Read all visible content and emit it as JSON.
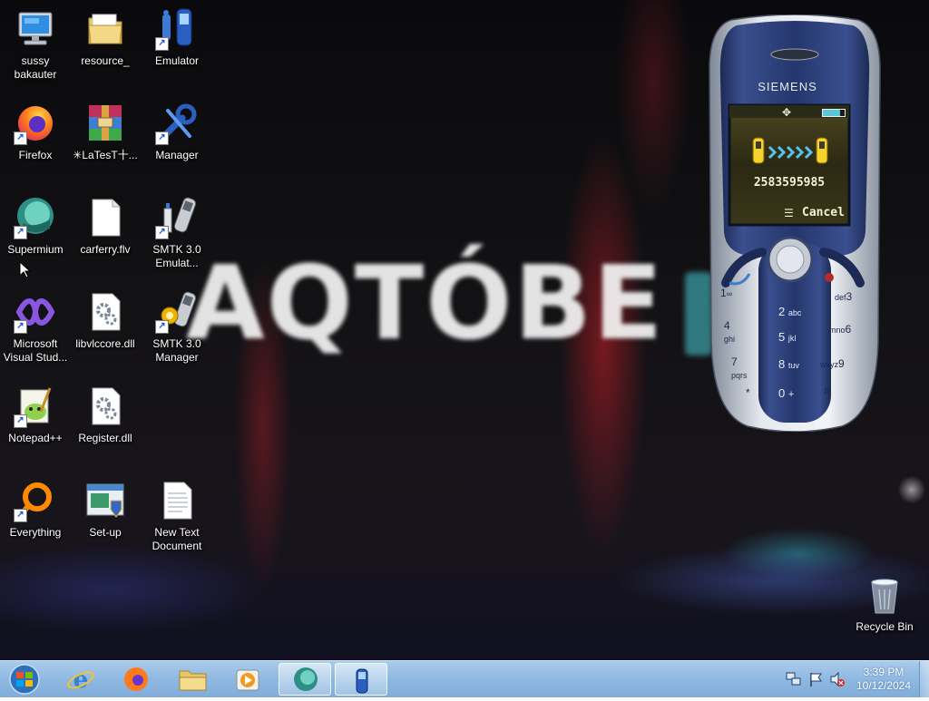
{
  "desktop": {
    "wallpaper_text": "AQTÓBE",
    "icons": [
      {
        "id": "sussy",
        "label": "sussy bakauter",
        "icon": "computer-icon",
        "shortcut": false
      },
      {
        "id": "resource",
        "label": "resource_",
        "icon": "folder-icon",
        "shortcut": false
      },
      {
        "id": "emulator",
        "label": "Emulator",
        "icon": "emulator-phone-icon",
        "shortcut": true
      },
      {
        "id": "firefox",
        "label": "Firefox",
        "icon": "firefox-icon",
        "shortcut": true
      },
      {
        "id": "latest",
        "label": "✳LaTesT十...",
        "icon": "winrar-icon",
        "shortcut": false
      },
      {
        "id": "manager",
        "label": "Manager",
        "icon": "manager-wrench-icon",
        "shortcut": true
      },
      {
        "id": "supermium",
        "label": "Supermium",
        "icon": "supermium-icon",
        "shortcut": true
      },
      {
        "id": "carferry",
        "label": "carferry.flv",
        "icon": "blank-file-icon",
        "shortcut": false
      },
      {
        "id": "smtk-emulator",
        "label": "SMTK 3.0 Emulat...",
        "icon": "smtk-phone-icon",
        "shortcut": true
      },
      {
        "id": "visual-studio",
        "label": "Microsoft Visual Stud...",
        "icon": "visual-studio-icon",
        "shortcut": true
      },
      {
        "id": "libvlccore",
        "label": "libvlccore.dll",
        "icon": "dll-gear-icon",
        "shortcut": false
      },
      {
        "id": "smtk-manager",
        "label": "SMTK 3.0 Manager",
        "icon": "smtk-manager-icon",
        "shortcut": true
      },
      {
        "id": "notepadpp",
        "label": "Notepad++",
        "icon": "notepadpp-icon",
        "shortcut": true
      },
      {
        "id": "register",
        "label": "Register.dll",
        "icon": "dll-gear-icon",
        "shortcut": false
      },
      {
        "id": "everything",
        "label": "Everything",
        "icon": "everything-icon",
        "shortcut": true
      },
      {
        "id": "setup",
        "label": "Set-up",
        "icon": "setup-installer-icon",
        "shortcut": false
      },
      {
        "id": "new-text",
        "label": "New Text Document",
        "icon": "text-document-icon",
        "shortcut": false
      },
      {
        "id": "recycle-bin",
        "label": "Recycle Bin",
        "icon": "recycle-bin-icon",
        "shortcut": false
      }
    ]
  },
  "phone": {
    "brand": "SIEMENS",
    "screen": {
      "number": "2583595985",
      "softkey": "Cancel",
      "status_icon": "antenna-icon",
      "battery_icon": "battery-icon"
    },
    "keys": {
      "k1": "1",
      "k1sub": "∞",
      "k2": "2",
      "k2sub": "abc",
      "k3": "3",
      "k3sub": "def",
      "k4": "4",
      "k4sub": "ghi",
      "k5": "5",
      "k5sub": "jkl",
      "k6": "6",
      "k6sub": "mno",
      "k7": "7",
      "k7sub": "pqrs",
      "k8": "8",
      "k8sub": "tuv",
      "k9": "9",
      "k9sub": "wxyz",
      "kstar": "*",
      "kstarsub": "",
      "k0": "0",
      "k0sub": "+",
      "khash": "#"
    }
  },
  "taskbar": {
    "apps": [
      "start-orb",
      "internet-explorer",
      "firefox",
      "file-explorer",
      "media-player",
      "supermium",
      "emulator"
    ],
    "clock": {
      "time": "3:39 PM",
      "date": "10/12/2024"
    }
  }
}
